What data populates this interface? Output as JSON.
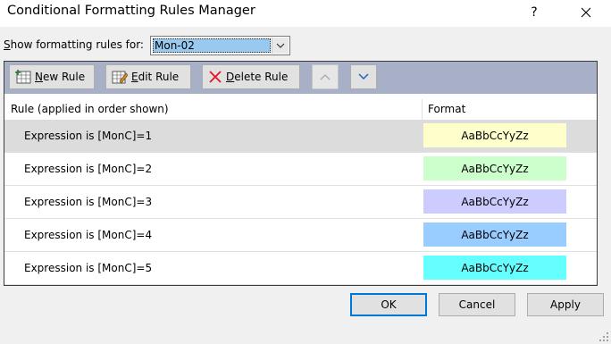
{
  "window": {
    "title": "Conditional Formatting Rules Manager",
    "help_glyph": "?",
    "close_glyph": "✕"
  },
  "show_rules": {
    "label_pre": "",
    "label_accel": "S",
    "label_post": "how formatting rules for:",
    "selected_value": "Mon-02"
  },
  "toolbar": {
    "new_rule": {
      "accel": "N",
      "rest": "ew Rule"
    },
    "edit_rule": {
      "accel": "E",
      "rest": "dit Rule"
    },
    "delete_rule": {
      "accel": "D",
      "rest": "elete Rule"
    }
  },
  "table": {
    "columns": {
      "rule": "Rule (applied in order shown)",
      "format": "Format"
    },
    "rows": [
      {
        "rule": "Expression is [MonC]=1",
        "preview": "AaBbCcYyZz",
        "color": "#ffffcc",
        "selected": true
      },
      {
        "rule": "Expression is [MonC]=2",
        "preview": "AaBbCcYyZz",
        "color": "#ccffcc",
        "selected": false
      },
      {
        "rule": "Expression is [MonC]=3",
        "preview": "AaBbCcYyZz",
        "color": "#ccccff",
        "selected": false
      },
      {
        "rule": "Expression is [MonC]=4",
        "preview": "AaBbCcYyZz",
        "color": "#99ccff",
        "selected": false
      },
      {
        "rule": "Expression is [MonC]=5",
        "preview": "AaBbCcYyZz",
        "color": "#66ffff",
        "selected": false
      }
    ]
  },
  "buttons": {
    "ok": "OK",
    "cancel": "Cancel",
    "apply": "Apply"
  },
  "colors": {
    "toolbar_bg": "#a7b0c6",
    "selection": "#99c9ef",
    "accent": "#0078d7",
    "delete_icon": "#e81123"
  }
}
